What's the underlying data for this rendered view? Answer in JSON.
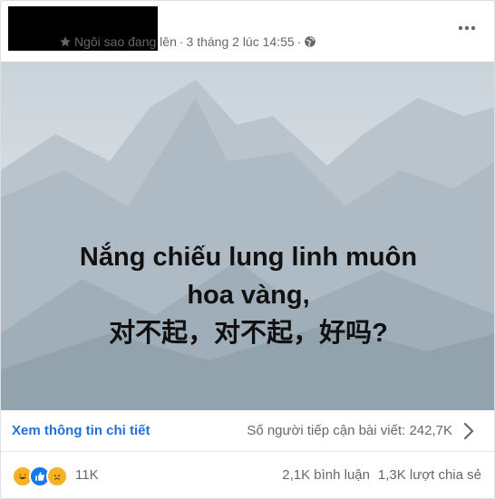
{
  "header": {
    "badge_label": "Ngôi sao đang lên",
    "separator": "·",
    "timestamp": "3 tháng 2 lúc 14:55",
    "separator2": "·",
    "badge_icon": "star-icon",
    "audience_icon": "globe-icon",
    "more_icon": "ellipsis-icon"
  },
  "post": {
    "caption_lines": [
      "Nắng chiếu lung linh muôn",
      "hoa vàng,",
      "对不起，对不起，好吗?"
    ]
  },
  "insights": {
    "detail_label": "Xem thông tin chi tiết",
    "reach_label": "Số người tiếp cận bài viết: 242,7K",
    "arrow_icon": "chevron-right-icon"
  },
  "engagement": {
    "reaction_icons": [
      "haha-icon",
      "like-icon",
      "sad-icon"
    ],
    "reaction_count": "11K",
    "comments": "2,1K bình luận",
    "shares": "1,3K lượt chia sẻ"
  },
  "colors": {
    "link": "#216fdb",
    "muted": "#65676b",
    "like": "#1877f2",
    "haha": "#f7b125"
  }
}
